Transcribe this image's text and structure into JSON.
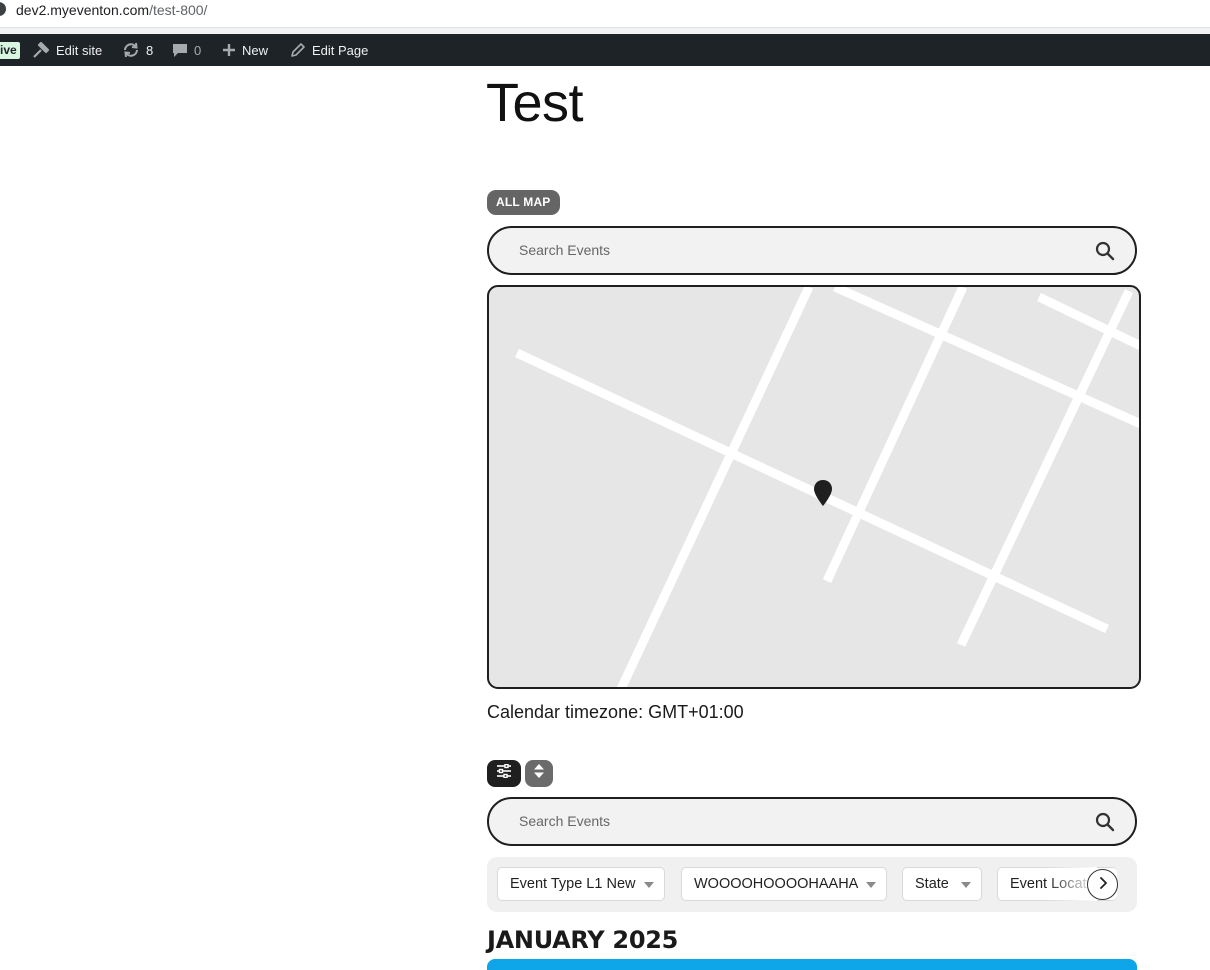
{
  "browser": {
    "url_host": "dev2.myeventon.com",
    "url_path": "/test-800/"
  },
  "admin_bar": {
    "live_badge": "ive",
    "edit_site": "Edit site",
    "updates_count": "8",
    "comments_count": "0",
    "new": "New",
    "edit_page": "Edit Page"
  },
  "page": {
    "title": "Test"
  },
  "map_section": {
    "all_map_label": "ALL MAP",
    "search_placeholder": "Search Events",
    "timezone_text": "Calendar timezone: GMT+01:00"
  },
  "calendar": {
    "search_placeholder": "Search Events",
    "filters": [
      {
        "label": "Event Type L1 New"
      },
      {
        "label": "WOOOOHOOOOHAAHA"
      },
      {
        "label": "State"
      },
      {
        "label": "Event Locat"
      }
    ],
    "month_title": "JANUARY 2025",
    "event_bar_color": "#0fa5e9"
  },
  "colors": {
    "admin_bar_bg": "#1d2327",
    "map_bg": "#e6e6e6",
    "button_dark": "#1f1f1f",
    "button_gray": "#656565"
  },
  "icons": [
    "site-info-icon",
    "edit-site-icon",
    "updates-icon",
    "comments-icon",
    "plus-icon",
    "pencil-icon",
    "search-icon",
    "map-pin-icon",
    "filter-sliders-icon",
    "sort-icon",
    "chevron-right-icon"
  ]
}
